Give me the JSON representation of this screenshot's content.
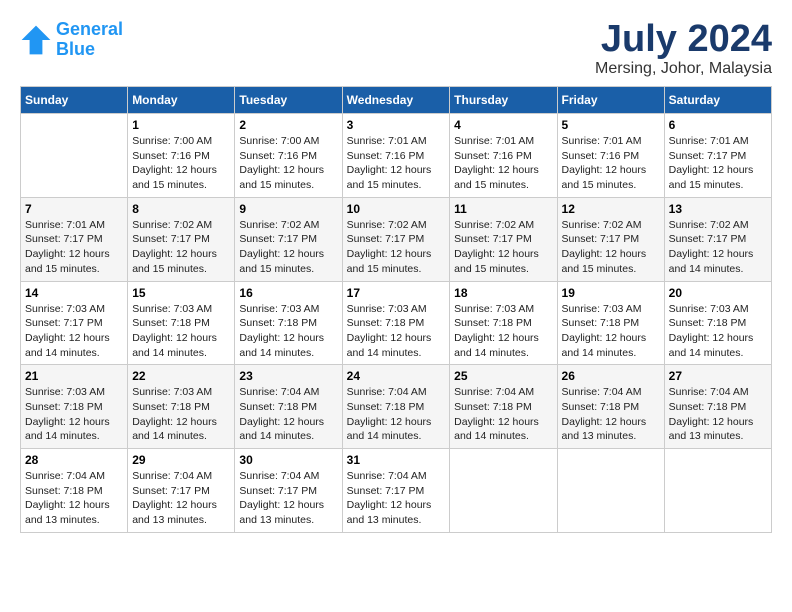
{
  "header": {
    "logo_line1": "General",
    "logo_line2": "Blue",
    "month_title": "July 2024",
    "location": "Mersing, Johor, Malaysia"
  },
  "days_of_week": [
    "Sunday",
    "Monday",
    "Tuesday",
    "Wednesday",
    "Thursday",
    "Friday",
    "Saturday"
  ],
  "weeks": [
    [
      {
        "day": "",
        "info": ""
      },
      {
        "day": "1",
        "info": "Sunrise: 7:00 AM\nSunset: 7:16 PM\nDaylight: 12 hours\nand 15 minutes."
      },
      {
        "day": "2",
        "info": "Sunrise: 7:00 AM\nSunset: 7:16 PM\nDaylight: 12 hours\nand 15 minutes."
      },
      {
        "day": "3",
        "info": "Sunrise: 7:01 AM\nSunset: 7:16 PM\nDaylight: 12 hours\nand 15 minutes."
      },
      {
        "day": "4",
        "info": "Sunrise: 7:01 AM\nSunset: 7:16 PM\nDaylight: 12 hours\nand 15 minutes."
      },
      {
        "day": "5",
        "info": "Sunrise: 7:01 AM\nSunset: 7:16 PM\nDaylight: 12 hours\nand 15 minutes."
      },
      {
        "day": "6",
        "info": "Sunrise: 7:01 AM\nSunset: 7:17 PM\nDaylight: 12 hours\nand 15 minutes."
      }
    ],
    [
      {
        "day": "7",
        "info": "Sunrise: 7:01 AM\nSunset: 7:17 PM\nDaylight: 12 hours\nand 15 minutes."
      },
      {
        "day": "8",
        "info": "Sunrise: 7:02 AM\nSunset: 7:17 PM\nDaylight: 12 hours\nand 15 minutes."
      },
      {
        "day": "9",
        "info": "Sunrise: 7:02 AM\nSunset: 7:17 PM\nDaylight: 12 hours\nand 15 minutes."
      },
      {
        "day": "10",
        "info": "Sunrise: 7:02 AM\nSunset: 7:17 PM\nDaylight: 12 hours\nand 15 minutes."
      },
      {
        "day": "11",
        "info": "Sunrise: 7:02 AM\nSunset: 7:17 PM\nDaylight: 12 hours\nand 15 minutes."
      },
      {
        "day": "12",
        "info": "Sunrise: 7:02 AM\nSunset: 7:17 PM\nDaylight: 12 hours\nand 15 minutes."
      },
      {
        "day": "13",
        "info": "Sunrise: 7:02 AM\nSunset: 7:17 PM\nDaylight: 12 hours\nand 14 minutes."
      }
    ],
    [
      {
        "day": "14",
        "info": "Sunrise: 7:03 AM\nSunset: 7:17 PM\nDaylight: 12 hours\nand 14 minutes."
      },
      {
        "day": "15",
        "info": "Sunrise: 7:03 AM\nSunset: 7:18 PM\nDaylight: 12 hours\nand 14 minutes."
      },
      {
        "day": "16",
        "info": "Sunrise: 7:03 AM\nSunset: 7:18 PM\nDaylight: 12 hours\nand 14 minutes."
      },
      {
        "day": "17",
        "info": "Sunrise: 7:03 AM\nSunset: 7:18 PM\nDaylight: 12 hours\nand 14 minutes."
      },
      {
        "day": "18",
        "info": "Sunrise: 7:03 AM\nSunset: 7:18 PM\nDaylight: 12 hours\nand 14 minutes."
      },
      {
        "day": "19",
        "info": "Sunrise: 7:03 AM\nSunset: 7:18 PM\nDaylight: 12 hours\nand 14 minutes."
      },
      {
        "day": "20",
        "info": "Sunrise: 7:03 AM\nSunset: 7:18 PM\nDaylight: 12 hours\nand 14 minutes."
      }
    ],
    [
      {
        "day": "21",
        "info": "Sunrise: 7:03 AM\nSunset: 7:18 PM\nDaylight: 12 hours\nand 14 minutes."
      },
      {
        "day": "22",
        "info": "Sunrise: 7:03 AM\nSunset: 7:18 PM\nDaylight: 12 hours\nand 14 minutes."
      },
      {
        "day": "23",
        "info": "Sunrise: 7:04 AM\nSunset: 7:18 PM\nDaylight: 12 hours\nand 14 minutes."
      },
      {
        "day": "24",
        "info": "Sunrise: 7:04 AM\nSunset: 7:18 PM\nDaylight: 12 hours\nand 14 minutes."
      },
      {
        "day": "25",
        "info": "Sunrise: 7:04 AM\nSunset: 7:18 PM\nDaylight: 12 hours\nand 14 minutes."
      },
      {
        "day": "26",
        "info": "Sunrise: 7:04 AM\nSunset: 7:18 PM\nDaylight: 12 hours\nand 13 minutes."
      },
      {
        "day": "27",
        "info": "Sunrise: 7:04 AM\nSunset: 7:18 PM\nDaylight: 12 hours\nand 13 minutes."
      }
    ],
    [
      {
        "day": "28",
        "info": "Sunrise: 7:04 AM\nSunset: 7:18 PM\nDaylight: 12 hours\nand 13 minutes."
      },
      {
        "day": "29",
        "info": "Sunrise: 7:04 AM\nSunset: 7:17 PM\nDaylight: 12 hours\nand 13 minutes."
      },
      {
        "day": "30",
        "info": "Sunrise: 7:04 AM\nSunset: 7:17 PM\nDaylight: 12 hours\nand 13 minutes."
      },
      {
        "day": "31",
        "info": "Sunrise: 7:04 AM\nSunset: 7:17 PM\nDaylight: 12 hours\nand 13 minutes."
      },
      {
        "day": "",
        "info": ""
      },
      {
        "day": "",
        "info": ""
      },
      {
        "day": "",
        "info": ""
      }
    ]
  ]
}
